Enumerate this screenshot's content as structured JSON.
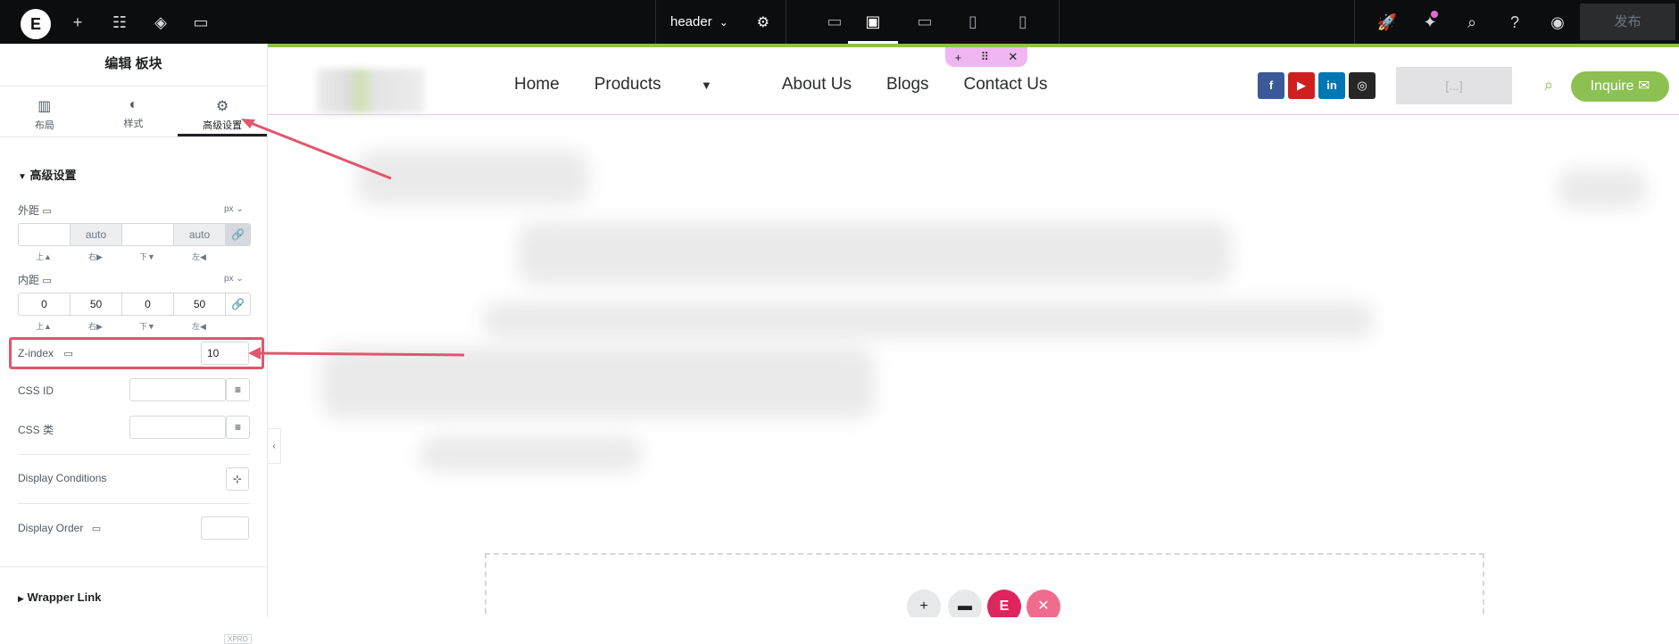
{
  "topbar": {
    "logo": "E",
    "document_name": "header",
    "publish_label": "发布"
  },
  "panel": {
    "title": "编辑 板块",
    "tabs": [
      {
        "label": "布局",
        "icon": "layout-icon"
      },
      {
        "label": "样式",
        "icon": "style-icon"
      },
      {
        "label": "高级设置",
        "icon": "gear-icon"
      }
    ],
    "section_title": "高级设置",
    "margin": {
      "label": "外距",
      "unit": "px",
      "values": [
        "",
        "auto",
        "",
        "auto"
      ],
      "sublabels": [
        "上▲",
        "右▶",
        "下▼",
        "左◀"
      ]
    },
    "padding": {
      "label": "内距",
      "unit": "px",
      "values": [
        "0",
        "50",
        "0",
        "50"
      ],
      "sublabels": [
        "上▲",
        "右▶",
        "下▼",
        "左◀"
      ]
    },
    "zindex": {
      "label": "Z-index",
      "value": "10"
    },
    "css_id": {
      "label": "CSS ID",
      "value": ""
    },
    "css_class": {
      "label": "CSS 类",
      "value": ""
    },
    "display_conditions": {
      "label": "Display Conditions"
    },
    "display_order": {
      "label": "Display Order",
      "value": ""
    },
    "wrapper_link": {
      "label": "Wrapper Link",
      "badge": "XPRO"
    }
  },
  "canvas": {
    "nav": [
      "Home",
      "Products",
      "About Us",
      "Blogs",
      "Contact Us"
    ],
    "placeholder": "[...]",
    "inquire_label": "Inquire",
    "accent": "#8cc152",
    "highlight_color": "#e0576e"
  }
}
